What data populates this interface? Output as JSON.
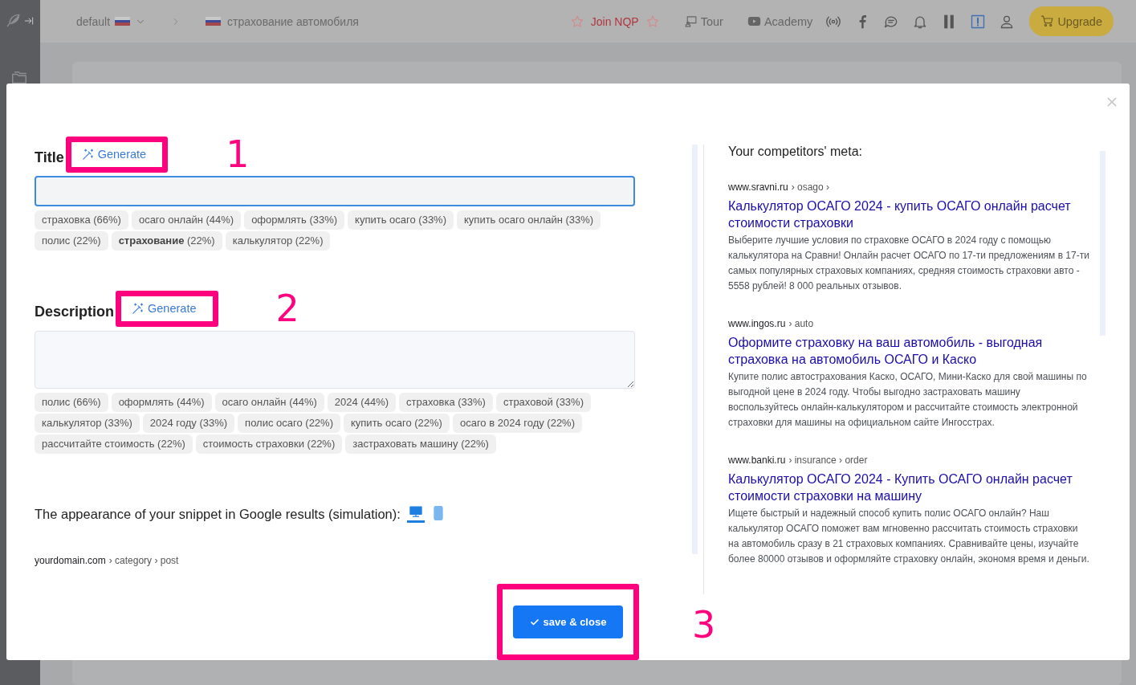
{
  "app_header": {
    "project": "default",
    "page": "страхование автомобиля",
    "join_link": "Join NQP",
    "tour_link": "Tour",
    "academy_link": "Academy",
    "upgrade_button": "Upgrade"
  },
  "modal": {
    "title_field": {
      "label": "Title",
      "generate_button": "Generate",
      "annotation": "1",
      "focused": true,
      "keywords": [
        "страховка (66%)",
        "осаго онлайн (44%)",
        "оформлять (33%)",
        "купить осаго (33%)",
        "купить осаго онлайн (33%)",
        "полис (22%)",
        "**страхование** (22%)",
        "калькулятор (22%)"
      ]
    },
    "description_field": {
      "label": "Description",
      "generate_button": "Generate",
      "annotation": "2",
      "focused": false,
      "keywords": [
        "полис (66%)",
        "оформлять (44%)",
        "осаго онлайн (44%)",
        "2024 (44%)",
        "страховка (33%)",
        "страховой (33%)",
        "калькулятор (33%)",
        "2024 году (33%)",
        "полис осаго (22%)",
        "купить осаго (22%)",
        "осаго в 2024 году (22%)",
        "рассчитайте стоимость (22%)",
        "стоимость страховки (22%)",
        "застраховать машину (22%)"
      ]
    },
    "snippet_preview": {
      "heading": "The appearance of your snippet in Google results (simulation):",
      "views": [
        {
          "kind": "desktop",
          "selected": true
        },
        {
          "kind": "mobile",
          "selected": false
        }
      ],
      "domain": "yourdomain.com",
      "path": "› category › post"
    },
    "save_button": {
      "label": "save & close",
      "annotation": "3"
    },
    "competitors": {
      "heading": "Your competitors' meta:",
      "items": [
        {
          "domain": "www.sravni.ru",
          "path": "› osago ›",
          "title": "Калькулятор ОСАГО 2024 - купить ОСАГО онлайн расчет стоимости страховки",
          "description": "Выберите лучшие условия по страховке ОСАГО в 2024 году с помощью калькулятора на Сравни! Онлайн расчет ОСАГО по 17-ти предложениям в 17-ти самых популярных страховых компаниях, средняя стоимость страховки авто - 5558 рублей! 8 000 реальных отзывов."
        },
        {
          "domain": "www.ingos.ru",
          "path": "› auto",
          "title": "Оформите страховку на ваш автомобиль - выгодная страховка на автомобиль ОСАГО и Каско",
          "description": "Купите полис автострахования Каско, ОСАГО, Мини-Каско для свой машины по выгодной цене в 2024 году. Чтобы выгодно застраховать машину воспользуйтесь онлайн-калькулятором и рассчитайте стоимость электронной страховки для машины на официальном сайте Ингосстрах."
        },
        {
          "domain": "www.banki.ru",
          "path": "› insurance › order",
          "title": "Калькулятор ОСАГО 2024 - Купить ОСАГО онлайн расчет стоимости страховки на машину",
          "description": "Ищете быстрый и надежный способ купить полис ОСАГО онлайн? Наш калькулятор ОСАГО поможет вам мгновенно рассчитать стоимость страховки на автомобиль сразу в 21 страховых компаниях. Сравнивайте цены, изучайте более 80000 отзывов и оформляйте страховку онлайн, экономя время и деньги."
        }
      ]
    }
  }
}
